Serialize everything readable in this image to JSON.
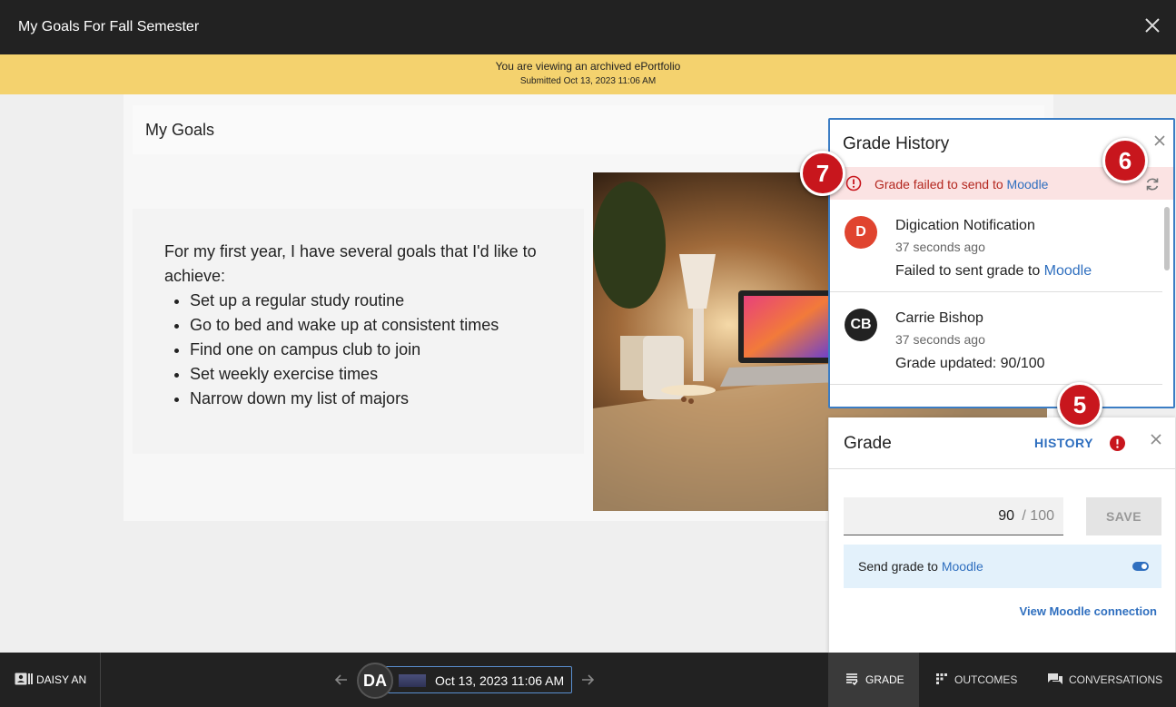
{
  "window": {
    "title": "My Goals For Fall Semester"
  },
  "banner": {
    "line1": "You are viewing an archived ePortfolio",
    "line2": "Submitted Oct 13, 2023 11:06 AM"
  },
  "page": {
    "section_title": "My Goals",
    "intro": "For my first year, I have several goals that I'd like to achieve:",
    "goals": [
      "Set up a regular study routine",
      "Go to bed and wake up at consistent times",
      "Find one on campus club to join",
      "Set weekly exercise times",
      "Narrow down my list of majors"
    ]
  },
  "history": {
    "title": "Grade History",
    "error_prefix": "Grade failed to send to ",
    "error_link": "Moodle",
    "entries": [
      {
        "initials": "D",
        "name": "Digication Notification",
        "time": "37 seconds ago",
        "body": "Failed to sent grade to ",
        "body_link": "Moodle",
        "color": "#e0442f"
      },
      {
        "initials": "CB",
        "name": "Carrie Bishop",
        "time": "37 seconds ago",
        "body": "Grade updated: 90/100",
        "body_link": "",
        "color": "#222222"
      }
    ]
  },
  "grade": {
    "title": "Grade",
    "history_label": "HISTORY",
    "score": "90",
    "max": "/ 100",
    "save_label": "SAVE",
    "send_prefix": "Send grade to ",
    "send_link": "Moodle",
    "view_connection": "View Moodle connection"
  },
  "bottom": {
    "student_name": "DAISY AN",
    "avatar_initials": "DA",
    "date": "Oct 13, 2023 11:06 AM",
    "tabs": [
      "GRADE",
      "OUTCOMES",
      "CONVERSATIONS"
    ]
  },
  "callouts": [
    "7",
    "6",
    "5"
  ],
  "colors": {
    "accent": "#2f6fbf",
    "error": "#c8161d",
    "banner": "#f4d26e",
    "dark": "#222222"
  }
}
